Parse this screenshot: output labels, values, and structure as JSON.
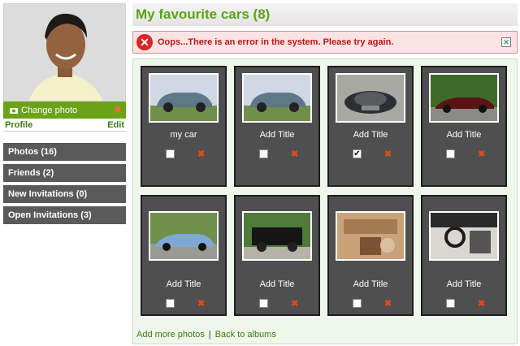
{
  "profile": {
    "change_photo_label": "Change photo",
    "profile_link": "Profile",
    "edit_link": "Edit"
  },
  "nav": {
    "items": [
      {
        "label": "Photos (16)"
      },
      {
        "label": "Friends (2)"
      },
      {
        "label": "New Invitations (0)"
      },
      {
        "label": "Open Invitations (3)"
      }
    ]
  },
  "main": {
    "title": "My favourite cars (8)",
    "error_message": "Oops...There is an error in the system. Please try again.",
    "photos": [
      {
        "title": "my car",
        "checked": false
      },
      {
        "title": "Add Title",
        "checked": false
      },
      {
        "title": "Add Title",
        "checked": true
      },
      {
        "title": "Add Title",
        "checked": false
      },
      {
        "title": "Add Title",
        "checked": false
      },
      {
        "title": "Add Title",
        "checked": false
      },
      {
        "title": "Add Title",
        "checked": false
      },
      {
        "title": "Add Title",
        "checked": false
      }
    ],
    "footer": {
      "add_more": "Add more photos",
      "separator": "|",
      "back": "Back to albums"
    }
  },
  "colors": {
    "accent_green": "#5aa316",
    "error_red": "#c01515",
    "tile_bg": "#4f4f4f",
    "nav_bg": "#5a5a5a"
  }
}
